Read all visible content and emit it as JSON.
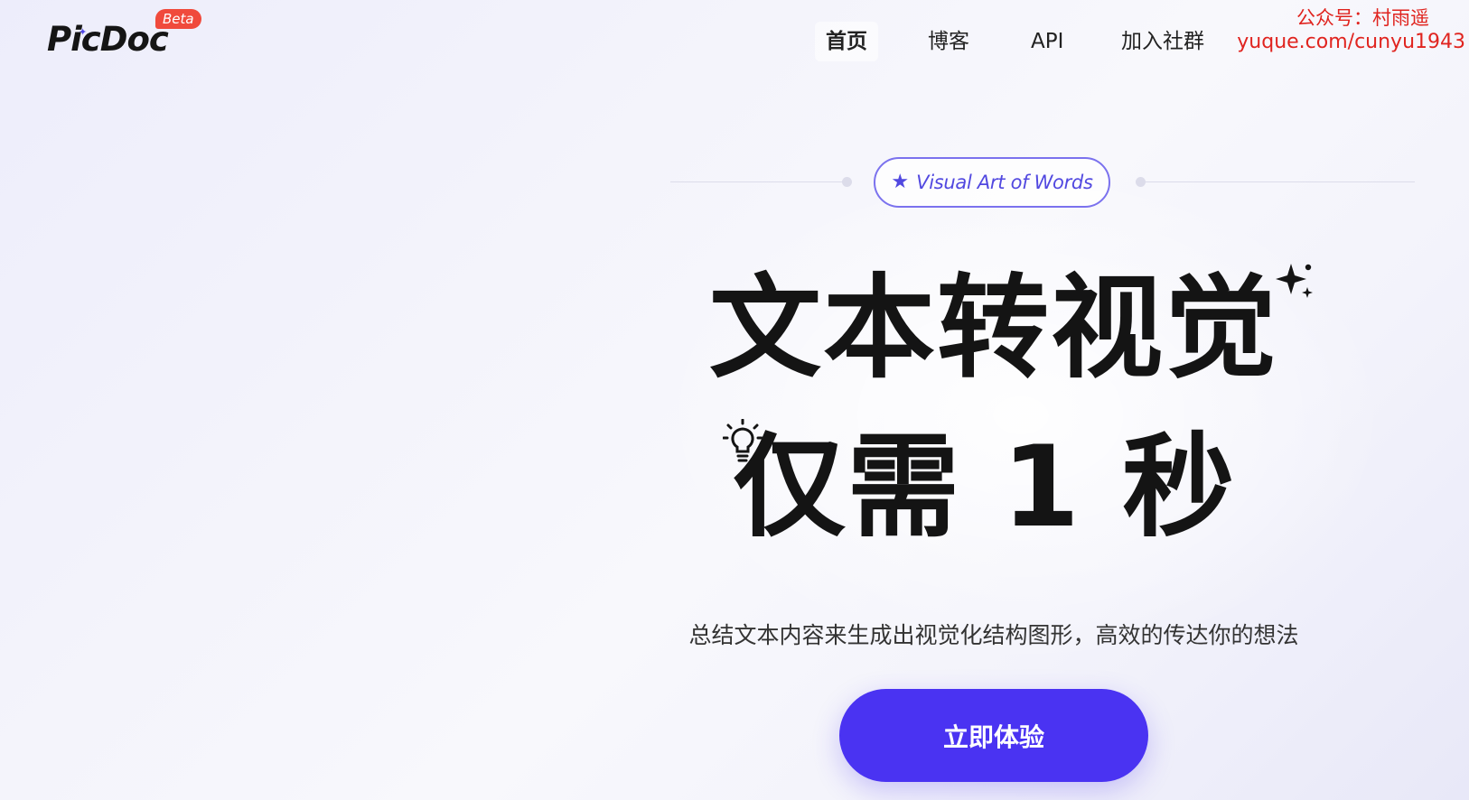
{
  "logo": {
    "name": "PicDoc",
    "badge": "Beta"
  },
  "nav": {
    "items": [
      {
        "label": "首页",
        "active": true
      },
      {
        "label": "博客",
        "active": false
      },
      {
        "label": "API",
        "active": false
      },
      {
        "label": "加入社群",
        "active": false
      }
    ]
  },
  "watermark": {
    "line1": "公众号：村雨遥",
    "line2": "yuque.com/cunyu1943",
    "color": "#e0241f"
  },
  "hero": {
    "pill_icon": "star-icon",
    "pill_text": "Visual Art of Words",
    "headline_line1": "文本转视觉",
    "headline_line2": "仅需 1 秒",
    "subtitle": "总结文本内容来生成出视觉化结构图形，高效的传达你的想法",
    "cta_label": "立即体验"
  },
  "colors": {
    "accent": "#4a33f2",
    "pill_accent": "#5148e0",
    "beta_badge": "#f04a3c",
    "headline": "#141414"
  },
  "icons": {
    "sparkle": "sparkle-icon",
    "bulb": "lightbulb-icon"
  }
}
